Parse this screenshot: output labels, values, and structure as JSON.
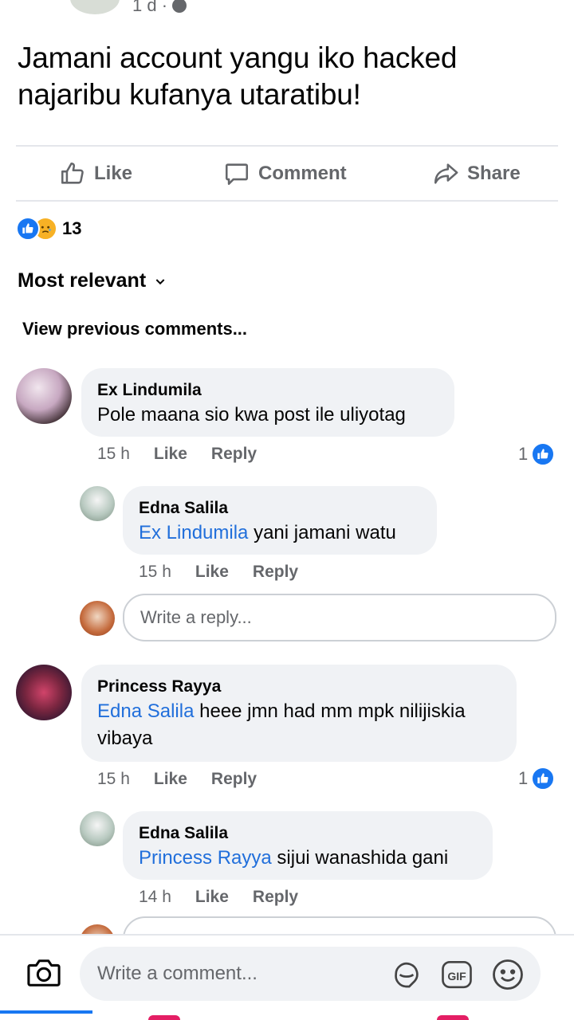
{
  "post": {
    "time": "1 d ·",
    "text": "Jamani account yangu iko hacked najaribu kufanya utaratibu!"
  },
  "actions": {
    "like": "Like",
    "comment": "Comment",
    "share": "Share"
  },
  "reactions": {
    "count": "13",
    "types": [
      "like",
      "sad"
    ]
  },
  "sort_label": "Most relevant",
  "view_previous": "View previous comments...",
  "comments": [
    {
      "author": "Ex Lindumila",
      "mention": "",
      "text": "Pole maana sio kwa post ile uliyotag",
      "time": "15 h",
      "like_label": "Like",
      "reply_label": "Reply",
      "like_count": "1",
      "replies": [
        {
          "author": "Edna Salila",
          "mention": "Ex Lindumila",
          "text": " yani jamani watu",
          "time": "15 h",
          "like_label": "Like",
          "reply_label": "Reply"
        }
      ]
    },
    {
      "author": "Princess Rayya",
      "mention": "Edna Salila",
      "text": " heee jmn had mm mpk nilijiskia vibaya",
      "time": "15 h",
      "like_label": "Like",
      "reply_label": "Reply",
      "like_count": "1",
      "replies": [
        {
          "author": "Edna Salila",
          "mention": "Princess Rayya",
          "text": " sijui wanashida gani",
          "time": "14 h",
          "like_label": "Like",
          "reply_label": "Reply"
        }
      ]
    }
  ],
  "reply_placeholder": "Write a reply...",
  "comment_placeholder": "Write a comment...",
  "bottom_icons": [
    "camera-icon",
    "sticker-icon",
    "gif-icon",
    "emoji-icon"
  ],
  "colors": {
    "brand": "#1877f2",
    "mention": "#216fdb",
    "bubble": "#f0f2f5",
    "muted": "#65676b"
  }
}
